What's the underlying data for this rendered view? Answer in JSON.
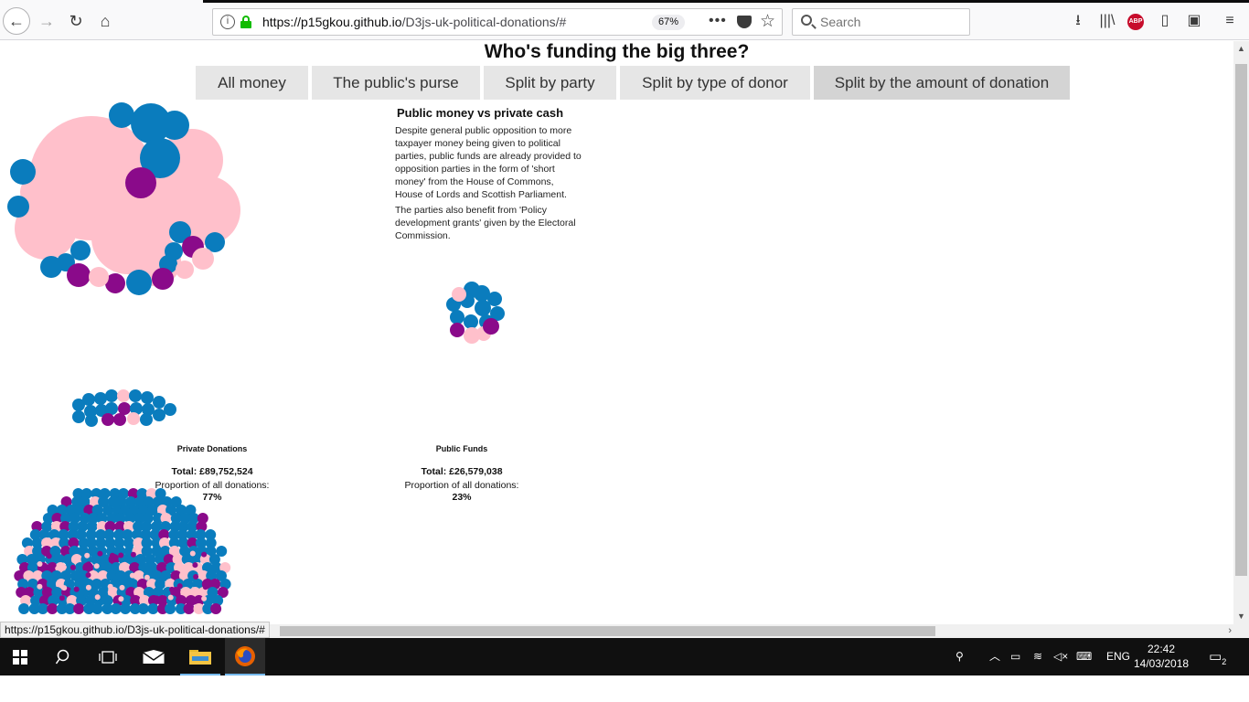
{
  "browser": {
    "url_host": "https://p15gkou.github.io",
    "url_path": "/D3js-uk-political-donations/#",
    "zoom": "67%",
    "search_placeholder": "Search",
    "abp_label": "ABP",
    "status_url": "https://p15gkou.github.io/D3js-uk-political-donations/#"
  },
  "page": {
    "title": "Who's funding the big three?",
    "buttons": [
      {
        "label": "All money"
      },
      {
        "label": "The public's purse"
      },
      {
        "label": "Split by party"
      },
      {
        "label": "Split by type of donor"
      },
      {
        "label": "Split by the amount of donation"
      }
    ],
    "panel": {
      "title": "Public money vs private cash",
      "paragraph1": "Despite general public opposition to more taxpayer money being given to political parties, public funds are already provided to opposition parties in the form of 'short money' from the House of Commons, House of Lords and Scottish Parliament.",
      "paragraph2": "The parties also benefit from 'Policy development grants' given by the Electoral Commission."
    },
    "private": {
      "label": "Private Donations",
      "total": "Total: £89,752,524",
      "proportion_label": "Proportion of all donations:",
      "pct": "77%"
    },
    "public": {
      "label": "Public Funds",
      "total": "Total: £26,579,038",
      "proportion_label": "Proportion of all donations:",
      "pct": "23%"
    },
    "colors": {
      "pink": "#ffc0cb",
      "blue": "#0a7cbd",
      "purple": "#8a0a8a"
    }
  },
  "taskbar": {
    "language": "ENG",
    "time": "22:42",
    "date": "14/03/2018",
    "notifications": "2"
  }
}
